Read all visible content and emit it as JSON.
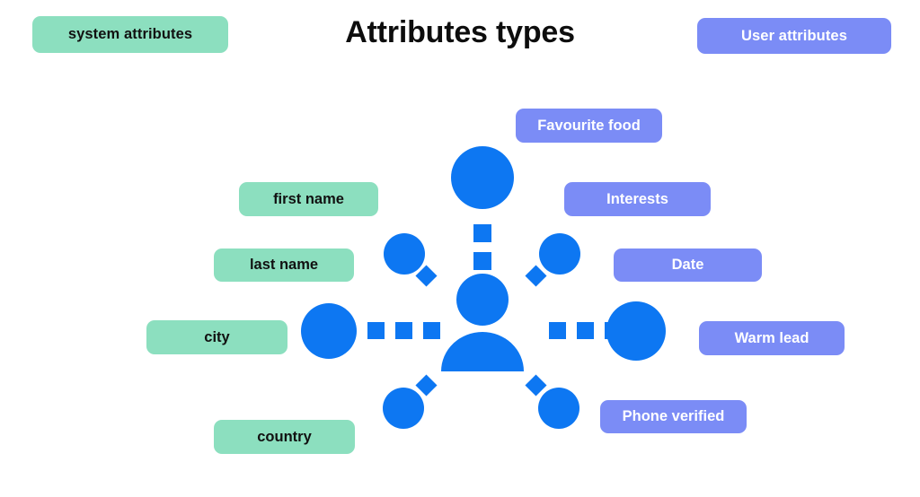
{
  "header": {
    "title": "Attributes types",
    "legend_left": "system attributes",
    "legend_right": "User attributes"
  },
  "colors": {
    "system_attribute": "#8CDFBF",
    "user_attribute": "#7B8CF6",
    "node_blue": "#0D77F2",
    "title_text": "#0D0D0D",
    "background": "#FFFFFF"
  },
  "diagram": {
    "center_icon": "user-person-icon",
    "system_attributes": [
      {
        "label": "first name"
      },
      {
        "label": "last name"
      },
      {
        "label": "city"
      },
      {
        "label": "country"
      }
    ],
    "user_attributes": [
      {
        "label": "Favourite food"
      },
      {
        "label": "Interests"
      },
      {
        "label": "Date"
      },
      {
        "label": "Warm lead"
      },
      {
        "label": "Phone verified"
      }
    ]
  }
}
